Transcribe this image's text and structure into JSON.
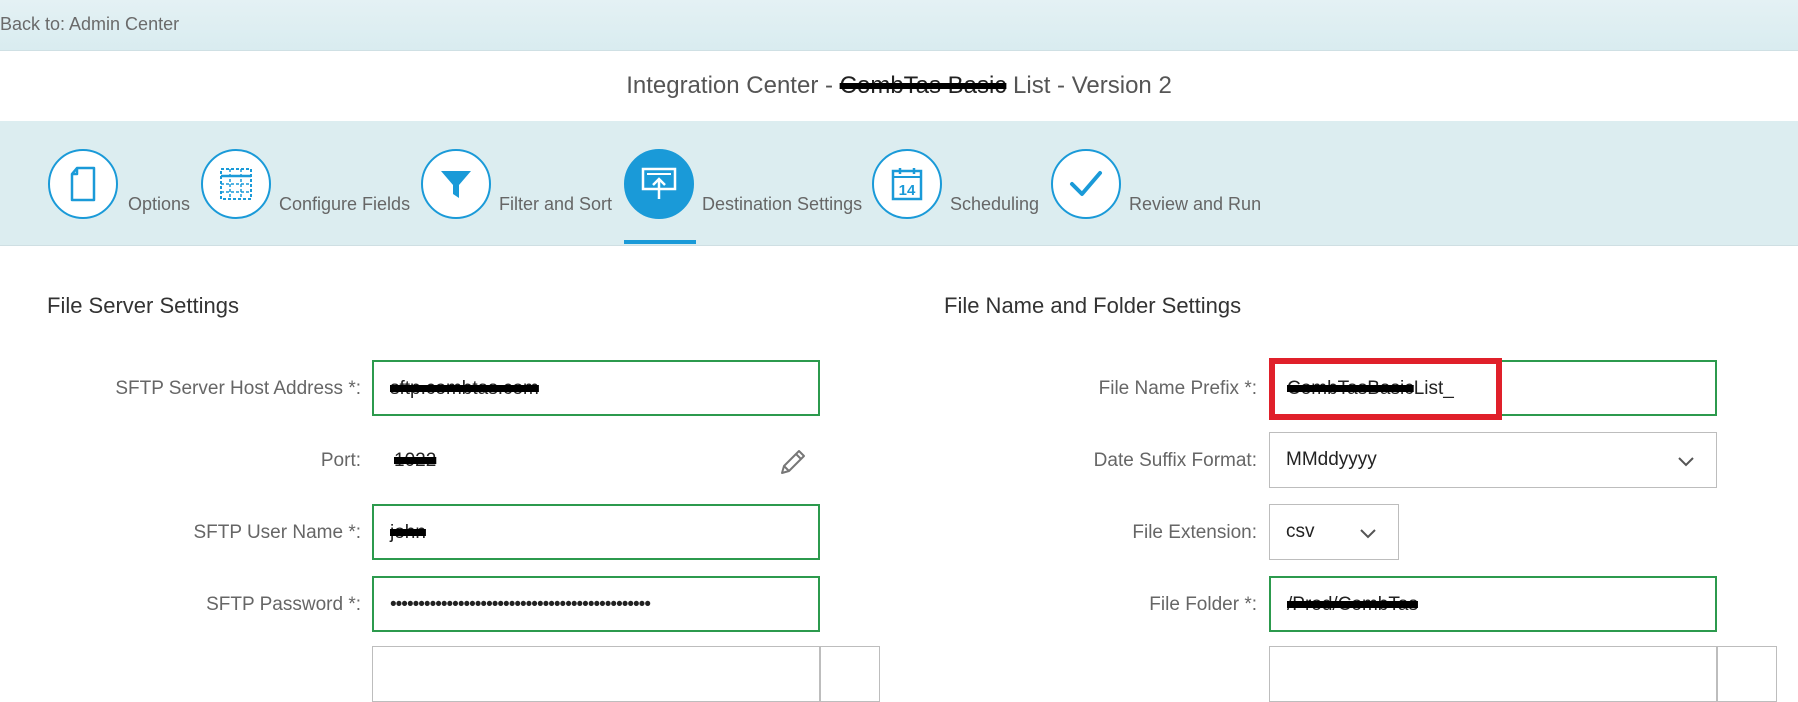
{
  "header": {
    "back_link": "Back to: Admin Center",
    "title_prefix": "Integration Center - ",
    "title_redacted": "CombTas Basic",
    "title_suffix": " List - Version 2"
  },
  "steps": [
    {
      "label": "Options",
      "icon": "document-icon"
    },
    {
      "label": "Configure Fields",
      "icon": "grid-icon"
    },
    {
      "label": "Filter and Sort",
      "icon": "filter-icon"
    },
    {
      "label": "Destination Settings",
      "icon": "upload-screen-icon",
      "active": true
    },
    {
      "label": "Scheduling",
      "icon": "calendar-icon",
      "calendar_day": "14"
    },
    {
      "label": "Review and Run",
      "icon": "checkmark-icon"
    }
  ],
  "file_server": {
    "title": "File Server Settings",
    "host_label": "SFTP Server Host Address *:",
    "host_value": "sftp.combtas.com",
    "port_label": "Port:",
    "port_value": "1022",
    "user_label": "SFTP User Name *:",
    "user_value": "john",
    "password_label": "SFTP Password *:",
    "password_value": "••••••••••••••••••••••••••••••••••••••••••••••"
  },
  "file_name": {
    "title": "File Name and Folder Settings",
    "prefix_label": "File Name Prefix *:",
    "prefix_redacted": "CombTasBasic",
    "prefix_suffix": "List_",
    "date_label": "Date Suffix Format:",
    "date_value": "MMddyyyy",
    "ext_label": "File Extension:",
    "ext_value": "csv",
    "folder_label": "File Folder *:",
    "folder_value": "/Prod/CombTas"
  },
  "colors": {
    "accent": "#1a9ad8",
    "valid_border": "#2c9a4d",
    "highlight": "#e0202a"
  }
}
